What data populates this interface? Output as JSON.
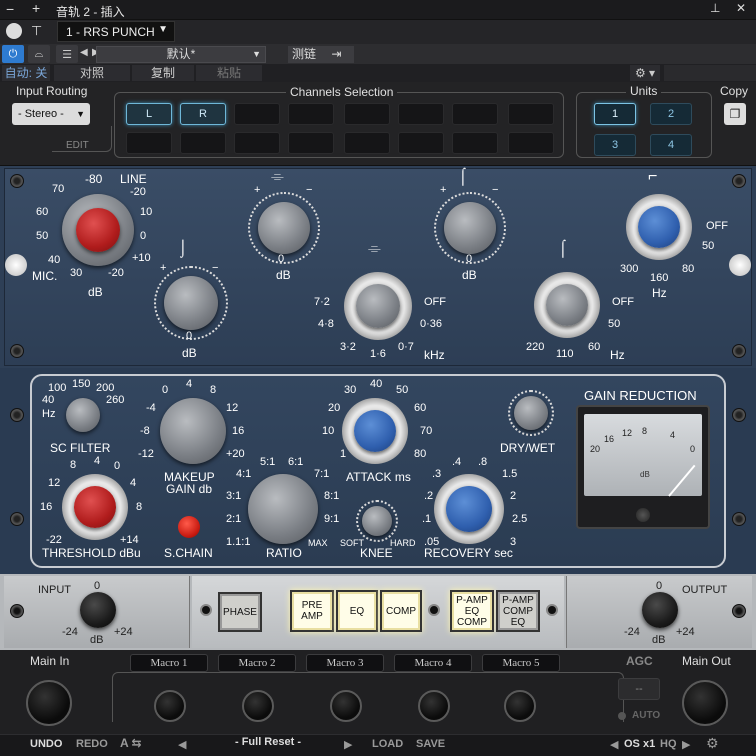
{
  "host": {
    "title": "音轨 2 - 插入",
    "track_name": "1 - RRS PUNCH",
    "preset_name": "默认*",
    "ab_label": "测链",
    "auto_label": "自动: 关",
    "compare_label": "对照",
    "copy_label": "复制",
    "paste_label": "粘贴"
  },
  "routing": {
    "input_routing_label": "Input Routing",
    "input_mode": "- Stereo -",
    "edit_label": "EDIT",
    "channels_label": "Channels Selection",
    "channel_L": "L",
    "channel_R": "R",
    "units_label": "Units",
    "units": [
      "1",
      "2",
      "3",
      "4"
    ],
    "copy_label": "Copy"
  },
  "eq": {
    "line": "LINE",
    "mic": "MIC.",
    "gain_scale_left": [
      "70",
      "60",
      "50",
      "40",
      "30"
    ],
    "gain_scale_top": "-80",
    "gain_scale_right": [
      "-20",
      "10",
      "0",
      "+10",
      "-20"
    ],
    "db": "dB",
    "plus": "+",
    "minus": "−",
    "zero": "0",
    "mid_freq_scale": [
      "7·2",
      "4·8",
      "3·2",
      "1·6",
      "0·7",
      "0·36",
      "OFF"
    ],
    "khz": "kHz",
    "lo_freq_scale": [
      "220",
      "110",
      "60",
      "50",
      "OFF"
    ],
    "hz": "Hz",
    "hpf_scale": [
      "300",
      "160",
      "80",
      "50",
      "OFF"
    ]
  },
  "comp": {
    "sc_filter": "SC FILTER",
    "sc_scale": [
      "100",
      "150",
      "200",
      "260",
      "40",
      "Hz"
    ],
    "makeup": "MAKEUP",
    "gain_db": "GAIN db",
    "makeup_scale": [
      "0",
      "4",
      "8",
      "12",
      "16",
      "+20",
      "-12",
      "-8",
      "-4"
    ],
    "attack": "ATTACK ms",
    "attack_scale": [
      "30",
      "40",
      "50",
      "60",
      "70",
      "80",
      "20",
      "10",
      "1"
    ],
    "drywet": "DRY/WET",
    "gain_reduction": "GAIN REDUCTION",
    "vu_scale": [
      "20",
      "16",
      "12",
      "8",
      "4",
      "0"
    ],
    "vu_db": "dB",
    "threshold": "THRESHOLD dBu",
    "threshold_scale": [
      "8",
      "4",
      "0",
      "12",
      "16",
      "-22",
      "+14",
      "4",
      "8"
    ],
    "schain": "S.CHAIN",
    "ratio": "RATIO",
    "ratio_scale": [
      "4:1",
      "5:1",
      "6:1",
      "7:1",
      "3:1",
      "8:1",
      "2:1",
      "9:1",
      "1.1:1",
      "MAX"
    ],
    "knee": "KNEE",
    "soft": "SOFT",
    "hard": "HARD",
    "recovery": "RECOVERY sec",
    "recovery_scale": [
      ".3",
      ".4",
      ".8",
      "1.5",
      ".2",
      "2",
      ".1",
      "2.5",
      ".05",
      "3"
    ]
  },
  "io": {
    "input": "INPUT",
    "output": "OUTPUT",
    "zero": "0",
    "minus24": "-24",
    "plus24": "+24",
    "db": "dB",
    "phase": "PHASE",
    "preamp": "PRE AMP",
    "eq": "EQ",
    "comp": "COMP",
    "order1": "P-AMP EQ COMP",
    "order2": "P-AMP COMP EQ"
  },
  "footer": {
    "main_in": "Main In",
    "main_out": "Main Out",
    "agc": "AGC",
    "agc_value": "--",
    "auto": "AUTO",
    "macros": [
      "Macro 1",
      "Macro 2",
      "Macro 3",
      "Macro 4",
      "Macro 5"
    ],
    "undo": "UNDO",
    "redo": "REDO",
    "preset": "- Full Reset -",
    "load": "LOAD",
    "save": "SAVE",
    "os": "OS x1",
    "hq": "HQ"
  }
}
